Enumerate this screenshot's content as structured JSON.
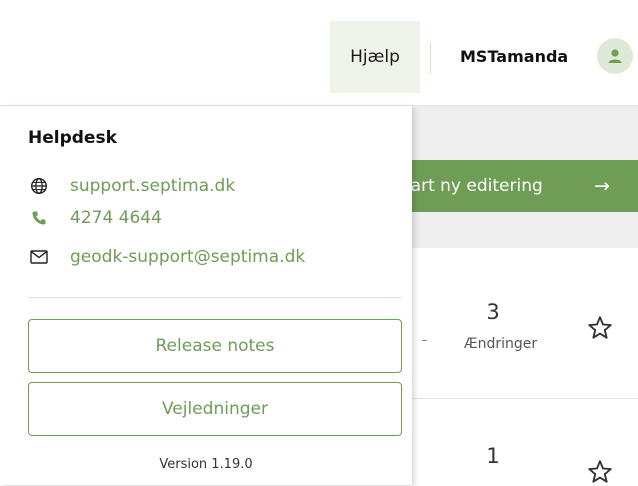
{
  "header": {
    "help_label": "Hjælp",
    "username": "MSTamanda",
    "avatar_icon": "user-icon"
  },
  "background": {
    "start_button_label": "tart ny editering",
    "start_button_arrow": "→",
    "rows": [
      {
        "count": "3",
        "label": "Ændringer"
      },
      {
        "count": "1",
        "label": ""
      }
    ],
    "star_icon": "star-outline-icon"
  },
  "helpdesk": {
    "title": "Helpdesk",
    "website": "support.septima.dk",
    "phone": "4274 4644",
    "email": "geodk-support@septima.dk",
    "release_notes_label": "Release notes",
    "guides_label": "Vejledninger",
    "version": "Version 1.19.0"
  },
  "colors": {
    "accent": "#6f9d56",
    "help_button_bg": "#eef3ea",
    "avatar_bg": "#dfe9d7"
  }
}
